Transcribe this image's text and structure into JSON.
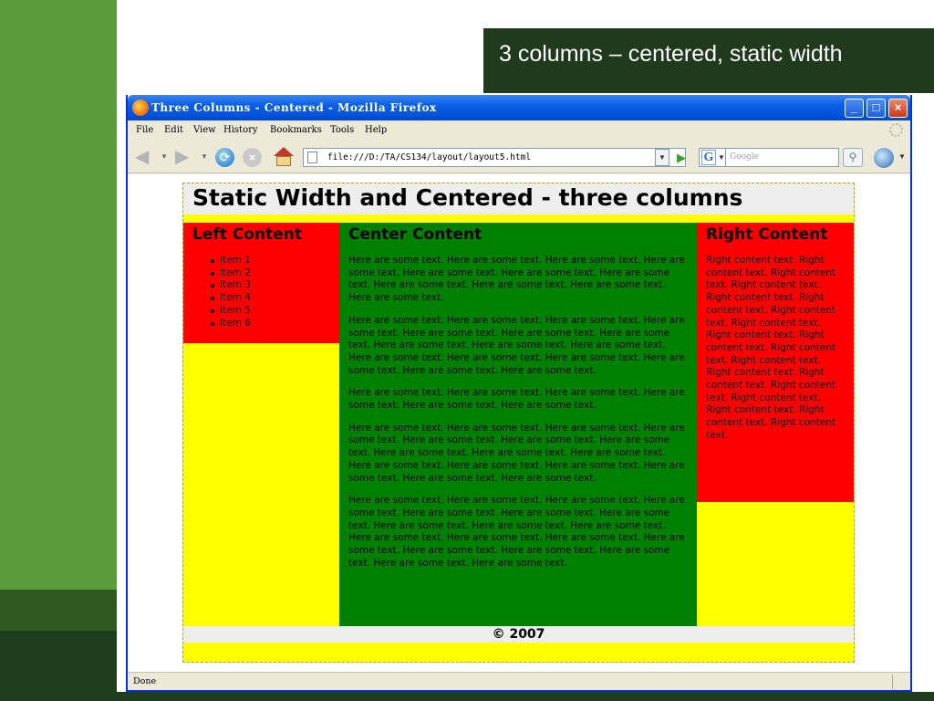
{
  "slide": {
    "title": "3 columns – centered, static width"
  },
  "browser": {
    "window_title": "Three Columns - Centered - Mozilla Firefox",
    "controls": {
      "minimize": "_",
      "maximize": "□",
      "close": "×"
    },
    "menu": [
      "File",
      "Edit",
      "View",
      "History",
      "Bookmarks",
      "Tools",
      "Help"
    ],
    "url": "file:///D:/TA/CS134/layout/layout5.html",
    "search_engine_letter": "G",
    "search_placeholder": "Google",
    "status": "Done"
  },
  "page": {
    "header": "Static Width and Centered - three columns",
    "left": {
      "title": "Left Content",
      "items": [
        "Item 1",
        "Item 2",
        "Item 3",
        "Item 4",
        "Item 5",
        "Item 6"
      ]
    },
    "center": {
      "title": "Center Content",
      "paragraphs": [
        "Here are some text. Here are some text. Here are some text. Here are some text. Here are some text. Here are some text. Here are some text. Here are some text. Here are some text. Here are some text. Here are some text.",
        "Here are some text. Here are some text. Here are some text. Here are some text. Here are some text. Here are some text. Here are some text. Here are some text. Here are some text. Here are some text. Here are some text. Here are some text. Here are some text. Here are some text. Here are some text. Here are some text.",
        "Here are some text. Here are some text. Here are some text. Here are some text. Here are some text. Here are some text.",
        "Here are some text. Here are some text. Here are some text. Here are some text. Here are some text. Here are some text. Here are some text. Here are some text. Here are some text. Here are some text. Here are some text. Here are some text. Here are some text. Here are some text. Here are some text. Here are some text.",
        "Here are some text. Here are some text. Here are some text. Here are some text. Here are some text. Here are some text. Here are some text. Here are some text. Here are some text. Here are some text. Here are some text. Here are some text. Here are some text. Here are some text. Here are some text. Here are some text. Here are some text. Here are some text. Here are some text."
      ]
    },
    "right": {
      "title": "Right Content",
      "text": "Right content text. Right content text. Right content text. Right content text. Right content text. Right content text. Right content text. Right content text. Right content text. Right content text. Right content text. Right content text. Right content text. Right content text. Right content text. Right content text. Right content text. Right content text. Right content text."
    },
    "footer": "© 2007"
  },
  "colors": {
    "page_bg": "#ffff00",
    "header_bg": "#eeeeee",
    "left_bg": "#ff0000",
    "center_bg": "#008000",
    "right_bg": "#ff0000",
    "slide_title_bg": "#1f3a1d",
    "slide_side_bar": "#5b9b3c"
  },
  "icons": [
    "firefox-icon",
    "back-icon",
    "forward-icon",
    "reload-icon",
    "stop-icon",
    "home-icon",
    "page-icon",
    "go-icon",
    "google-icon",
    "search-icon",
    "extension-icon",
    "gear-icon"
  ]
}
